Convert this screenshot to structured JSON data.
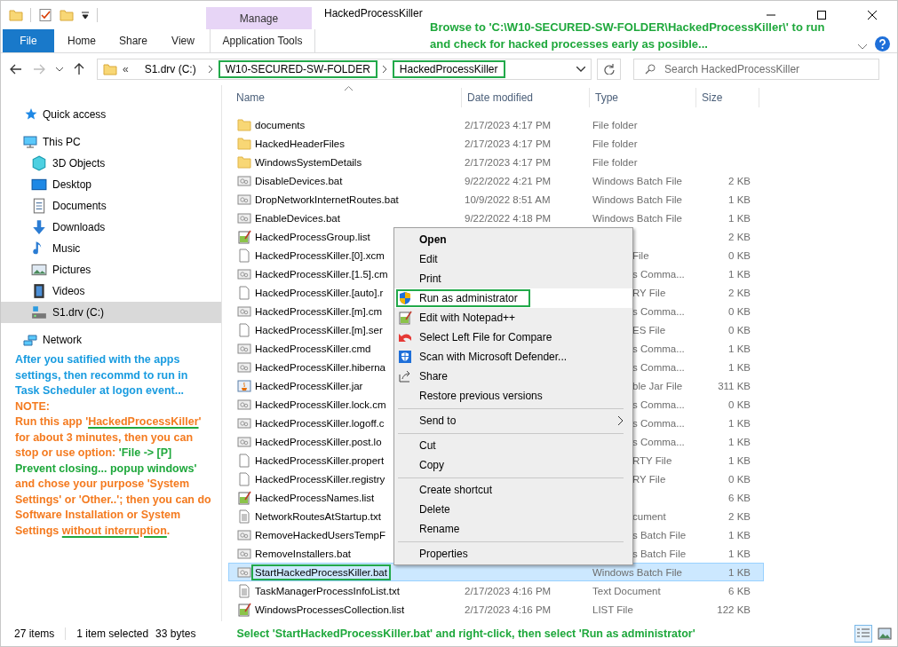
{
  "window": {
    "title": "HackedProcessKiller",
    "context_tab": "Manage"
  },
  "ribbon_tabs": [
    {
      "label": "File",
      "kind": "file"
    },
    {
      "label": "Home",
      "kind": "tab"
    },
    {
      "label": "Share",
      "kind": "tab"
    },
    {
      "label": "View",
      "kind": "tab"
    },
    {
      "label": "Application Tools",
      "kind": "context"
    }
  ],
  "top_note": "Browse to 'C:\\W10-SECURED-SW-FOLDER\\HackedProcessKiller\\' to run and check for hacked processes early as posible...",
  "address": {
    "prefix": "«",
    "crumbs": [
      {
        "label": "S1.drv (C:)",
        "highlighted": false
      },
      {
        "label": "W10-SECURED-SW-FOLDER",
        "highlighted": true
      },
      {
        "label": "HackedProcessKiller",
        "highlighted": true
      }
    ]
  },
  "search": {
    "placeholder": "Search HackedProcessKiller"
  },
  "sidebar": {
    "items": [
      {
        "kind": "quick-access",
        "label": "Quick access",
        "selected": false
      },
      {
        "kind": "pc",
        "label": "This PC",
        "selected": false,
        "children": [
          {
            "kind": "objects",
            "label": "3D Objects",
            "selected": false
          },
          {
            "kind": "desktop",
            "label": "Desktop",
            "selected": false
          },
          {
            "kind": "documents",
            "label": "Documents",
            "selected": false
          },
          {
            "kind": "downloads",
            "label": "Downloads",
            "selected": false
          },
          {
            "kind": "music",
            "label": "Music",
            "selected": false
          },
          {
            "kind": "pictures",
            "label": "Pictures",
            "selected": false
          },
          {
            "kind": "videos",
            "label": "Videos",
            "selected": false
          },
          {
            "kind": "drive",
            "label": "S1.drv (C:)",
            "selected": true
          }
        ]
      },
      {
        "kind": "network",
        "label": "Network",
        "selected": false
      }
    ]
  },
  "sidebar_note": {
    "intro": "After you satified with the apps settings, then recommd to run in Task Scheduler at logon event...",
    "title": "NOTE:",
    "segments": [
      {
        "text": "Run this app '",
        "color": "#f47b20",
        "underlined": false
      },
      {
        "text": "HackedProcessKiller",
        "color": "#f47b20",
        "underlined": true
      },
      {
        "text": "' for about 3 minutes, then you can stop or use option: ",
        "color": "#f47b20",
        "underlined": false
      },
      {
        "text": "'File -> [P] Prevent closing... popup windows'",
        "color": "#1fa83c",
        "underlined": false
      },
      {
        "text": " and chose your purpose 'System Settings' or 'Other..'; then you can do Software Installation or System Settings ",
        "color": "#f47b20",
        "underlined": false
      },
      {
        "text": "without interruption",
        "color": "#f47b20",
        "underlined": true,
        "tail": "."
      }
    ]
  },
  "columns": [
    "Name",
    "Date modified",
    "Type",
    "Size"
  ],
  "rows": [
    {
      "kind": "folder",
      "name": "documents",
      "date": "2/17/2023 4:17 PM",
      "type": "File folder",
      "selected": false,
      "highlighted": false
    },
    {
      "kind": "folder",
      "name": "HackedHeaderFiles",
      "date": "2/17/2023 4:17 PM",
      "type": "File folder",
      "selected": false,
      "highlighted": false
    },
    {
      "kind": "folder",
      "name": "WindowsSystemDetails",
      "date": "2/17/2023 4:17 PM",
      "type": "File folder",
      "selected": false,
      "highlighted": false
    },
    {
      "kind": "batch",
      "name": "DisableDevices.bat",
      "date": "9/22/2022 4:21 PM",
      "type": "Windows Batch File",
      "size": "2 KB",
      "selected": false,
      "highlighted": false
    },
    {
      "kind": "batch",
      "name": "DropNetworkInternetRoutes.bat",
      "date": "10/9/2022 8:51 AM",
      "type": "Windows Batch File",
      "size": "1 KB",
      "selected": false,
      "highlighted": false
    },
    {
      "kind": "batch",
      "name": "EnableDevices.bat",
      "date": "9/22/2022 4:18 PM",
      "type": "Windows Batch File",
      "size": "1 KB",
      "selected": false,
      "highlighted": false
    },
    {
      "kind": "list",
      "name": "HackedProcessGroup.list",
      "size": "2 KB",
      "selected": false,
      "highlighted": false
    },
    {
      "kind": "blank",
      "name": "HackedProcessKiller.[0].xcm",
      "type_tail": "File",
      "size": "0 KB",
      "selected": false,
      "highlighted": false
    },
    {
      "kind": "batch",
      "name": "HackedProcessKiller.[1.5].cm",
      "type_tail": "s Comma...",
      "size": "1 KB",
      "selected": false,
      "highlighted": false
    },
    {
      "kind": "blank",
      "name": "HackedProcessKiller.[auto].r",
      "type_tail": "RY File",
      "size": "2 KB",
      "selected": false,
      "highlighted": false
    },
    {
      "kind": "batch",
      "name": "HackedProcessKiller.[m].cm",
      "type_tail": "s Comma...",
      "size": "0 KB",
      "selected": false,
      "highlighted": false
    },
    {
      "kind": "blank",
      "name": "HackedProcessKiller.[m].ser",
      "type_tail": "ES File",
      "size": "0 KB",
      "selected": false,
      "highlighted": false
    },
    {
      "kind": "batch",
      "name": "HackedProcessKiller.cmd",
      "type_tail": "s Comma...",
      "size": "1 KB",
      "selected": false,
      "highlighted": false
    },
    {
      "kind": "batch",
      "name": "HackedProcessKiller.hiberna",
      "type_tail": "s Comma...",
      "size": "1 KB",
      "selected": false,
      "highlighted": false
    },
    {
      "kind": "jar",
      "name": "HackedProcessKiller.jar",
      "type_tail": "ble Jar File",
      "size": "311 KB",
      "selected": false,
      "highlighted": false
    },
    {
      "kind": "batch",
      "name": "HackedProcessKiller.lock.cm",
      "type_tail": "s Comma...",
      "size": "0 KB",
      "selected": false,
      "highlighted": false
    },
    {
      "kind": "batch",
      "name": "HackedProcessKiller.logoff.c",
      "type_tail": "s Comma...",
      "size": "1 KB",
      "selected": false,
      "highlighted": false
    },
    {
      "kind": "batch",
      "name": "HackedProcessKiller.post.lo",
      "type_tail": "s Comma...",
      "size": "1 KB",
      "selected": false,
      "highlighted": false
    },
    {
      "kind": "blank",
      "name": "HackedProcessKiller.propert",
      "type_tail": "RTY File",
      "size": "1 KB",
      "selected": false,
      "highlighted": false
    },
    {
      "kind": "blank",
      "name": "HackedProcessKiller.registry",
      "type_tail": "RY File",
      "size": "0 KB",
      "selected": false,
      "highlighted": false
    },
    {
      "kind": "list",
      "name": "HackedProcessNames.list",
      "size": "6 KB",
      "selected": false,
      "highlighted": false
    },
    {
      "kind": "text",
      "name": "NetworkRoutesAtStartup.txt",
      "type_tail": "cument",
      "size": "2 KB",
      "selected": false,
      "highlighted": false
    },
    {
      "kind": "batch",
      "name": "RemoveHackedUsersTempF",
      "type_tail": "s Batch File",
      "size": "1 KB",
      "selected": false,
      "highlighted": false
    },
    {
      "kind": "batch",
      "name": "RemoveInstallers.bat",
      "type_tail": "s Batch File",
      "size": "1 KB",
      "selected": false,
      "highlighted": false
    },
    {
      "kind": "batch",
      "name": "StartHackedProcessKiller.bat",
      "type": "Windows Batch File",
      "size": "1 KB",
      "selected": true,
      "highlighted": true
    },
    {
      "kind": "text",
      "name": "TaskManagerProcessInfoList.txt",
      "date": "2/17/2023 4:16 PM",
      "type": "Text Document",
      "size": "6 KB",
      "selected": false,
      "highlighted": false
    },
    {
      "kind": "list",
      "name": "WindowsProcessesCollection.list",
      "date": "2/17/2023 4:16 PM",
      "type": "LIST File",
      "size": "122 KB",
      "selected": false,
      "highlighted": false
    }
  ],
  "context_menu": {
    "items": [
      {
        "kind": "item",
        "label": "Open",
        "default": true,
        "selected": false,
        "highlighted": false
      },
      {
        "kind": "item",
        "label": "Edit",
        "default": false,
        "selected": false,
        "highlighted": false
      },
      {
        "kind": "item",
        "label": "Print",
        "default": false,
        "selected": false,
        "highlighted": false
      },
      {
        "kind": "shield",
        "label": "Run as administrator",
        "default": false,
        "selected": true,
        "highlighted": true
      },
      {
        "kind": "notepad",
        "label": "Edit with Notepad++",
        "default": false,
        "selected": false,
        "highlighted": false
      },
      {
        "kind": "compare",
        "label": "Select Left File for Compare",
        "default": false,
        "selected": false,
        "highlighted": false
      },
      {
        "kind": "defender",
        "label": "Scan with Microsoft Defender...",
        "default": false,
        "selected": false,
        "highlighted": false
      },
      {
        "kind": "share",
        "label": "Share",
        "default": false,
        "selected": false,
        "highlighted": false
      },
      {
        "kind": "item",
        "label": "Restore previous versions",
        "default": false,
        "selected": false,
        "highlighted": false
      },
      {
        "kind": "separator"
      },
      {
        "kind": "submenu",
        "label": "Send to",
        "default": false,
        "selected": false,
        "highlighted": false
      },
      {
        "kind": "separator"
      },
      {
        "kind": "item",
        "label": "Cut",
        "default": false,
        "selected": false,
        "highlighted": false
      },
      {
        "kind": "item",
        "label": "Copy",
        "default": false,
        "selected": false,
        "highlighted": false
      },
      {
        "kind": "separator"
      },
      {
        "kind": "item",
        "label": "Create shortcut",
        "default": false,
        "selected": false,
        "highlighted": false
      },
      {
        "kind": "item",
        "label": "Delete",
        "default": false,
        "selected": false,
        "highlighted": false
      },
      {
        "kind": "item",
        "label": "Rename",
        "default": false,
        "selected": false,
        "highlighted": false
      },
      {
        "kind": "separator"
      },
      {
        "kind": "item",
        "label": "Properties",
        "default": false,
        "selected": false,
        "highlighted": false
      }
    ]
  },
  "status_bar": {
    "count": "27 items",
    "selection": "1 item selected",
    "size": "33 bytes",
    "note": "Select 'StartHackedProcessKiller.bat' and right-click, then select 'Run as administrator'",
    "views": [
      {
        "kind": "details",
        "selected": true
      },
      {
        "kind": "large-icons",
        "selected": false
      }
    ]
  }
}
